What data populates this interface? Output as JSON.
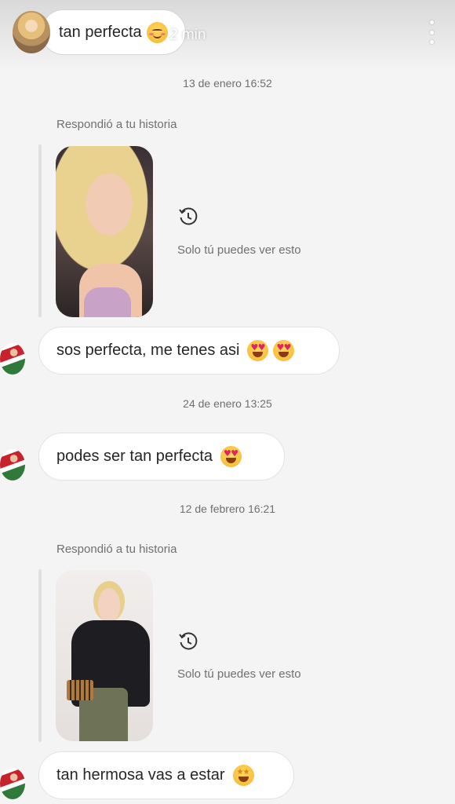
{
  "story_header": {
    "username": "",
    "time_ago": "2 min"
  },
  "top_bubble": {
    "text": "tan perfecta",
    "emoji": "smiling-face-with-hearts"
  },
  "timestamps": {
    "t1": "13 de enero 16:52",
    "t2": "24 de enero 13:25",
    "t3": "12 de febrero 16:21"
  },
  "story_replies": [
    {
      "label": "Respondió a tu historia",
      "note": "Solo tú puedes ver esto"
    },
    {
      "label": "Respondió a tu historia",
      "note": "Solo tú puedes ver esto"
    }
  ],
  "messages": [
    {
      "text": "sos perfecta, me tenes asi",
      "emojis": [
        "heart-eyes",
        "heart-eyes"
      ]
    },
    {
      "text": "podes ser tan perfecta",
      "emojis": [
        "heart-eyes"
      ]
    },
    {
      "text": "tan hermosa vas a estar",
      "emojis": [
        "star-struck"
      ]
    }
  ],
  "colors": {
    "background": "#f4f4f4",
    "bubble": "#ffffff",
    "bubble_border": "#e3e3e3",
    "meta_text": "#6f6f6f"
  }
}
